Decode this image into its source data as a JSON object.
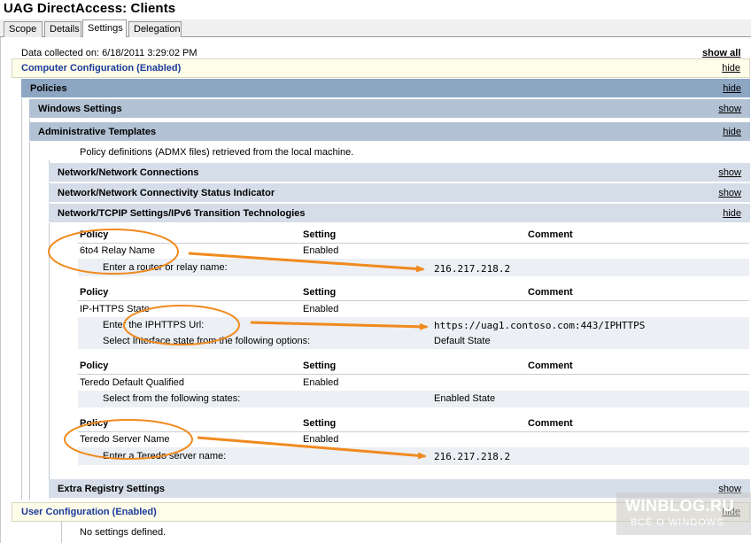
{
  "window": {
    "title": "UAG DirectAccess: Clients"
  },
  "tabs": [
    {
      "label": "Scope",
      "active": false
    },
    {
      "label": "Details",
      "active": false
    },
    {
      "label": "Settings",
      "active": true
    },
    {
      "label": "Delegation",
      "active": false
    }
  ],
  "report": {
    "collected": "Data collected on: 6/18/2011 3:29:02 PM",
    "show_all": "show all"
  },
  "sections": {
    "computer_config": {
      "label": "Computer Configuration (Enabled)",
      "link": "hide"
    },
    "policies": {
      "label": "Policies",
      "link": "hide"
    },
    "windows_settings": {
      "label": "Windows Settings",
      "link": "show"
    },
    "admin_templates": {
      "label": "Administrative Templates",
      "link": "hide",
      "note": "Policy definitions (ADMX files) retrieved from the local machine."
    },
    "net_connections": {
      "label": "Network/Network Connections",
      "link": "show"
    },
    "net_status": {
      "label": "Network/Network Connectivity Status Indicator",
      "link": "show"
    },
    "tcpip": {
      "label": "Network/TCPIP Settings/IPv6 Transition Technologies",
      "link": "hide"
    },
    "extra_registry": {
      "label": "Extra Registry Settings",
      "link": "show"
    },
    "user_config": {
      "label": "User Configuration (Enabled)",
      "link": "hide",
      "note": "No settings defined."
    }
  },
  "table_headers": {
    "policy": "Policy",
    "setting": "Setting",
    "comment": "Comment"
  },
  "policies": [
    {
      "name": "6to4 Relay Name",
      "setting": "Enabled",
      "details": [
        {
          "label": "Enter a router or relay name:",
          "value": "216.217.218.2"
        }
      ]
    },
    {
      "name": "IP-HTTPS State",
      "setting": "Enabled",
      "details": [
        {
          "label": "Enter the IPHTTPS Url:",
          "value": "https://uag1.contoso.com:443/IPHTTPS"
        },
        {
          "label": "Select Interface state from the following options:",
          "value": "Default State"
        }
      ]
    },
    {
      "name": "Teredo Default Qualified",
      "setting": "Enabled",
      "details": [
        {
          "label": "Select from the following states:",
          "value": "Enabled State"
        }
      ]
    },
    {
      "name": "Teredo Server Name",
      "setting": "Enabled",
      "details": [
        {
          "label": "Enter a Teredo server name:",
          "value": "216.217.218.2"
        }
      ]
    }
  ],
  "watermark": {
    "line1": "WINBLOG.RU",
    "line2": "ВСЁ О WINDOWS"
  },
  "colors": {
    "annotation": "#f08a1e",
    "link_blue": "#1b3a9a"
  }
}
